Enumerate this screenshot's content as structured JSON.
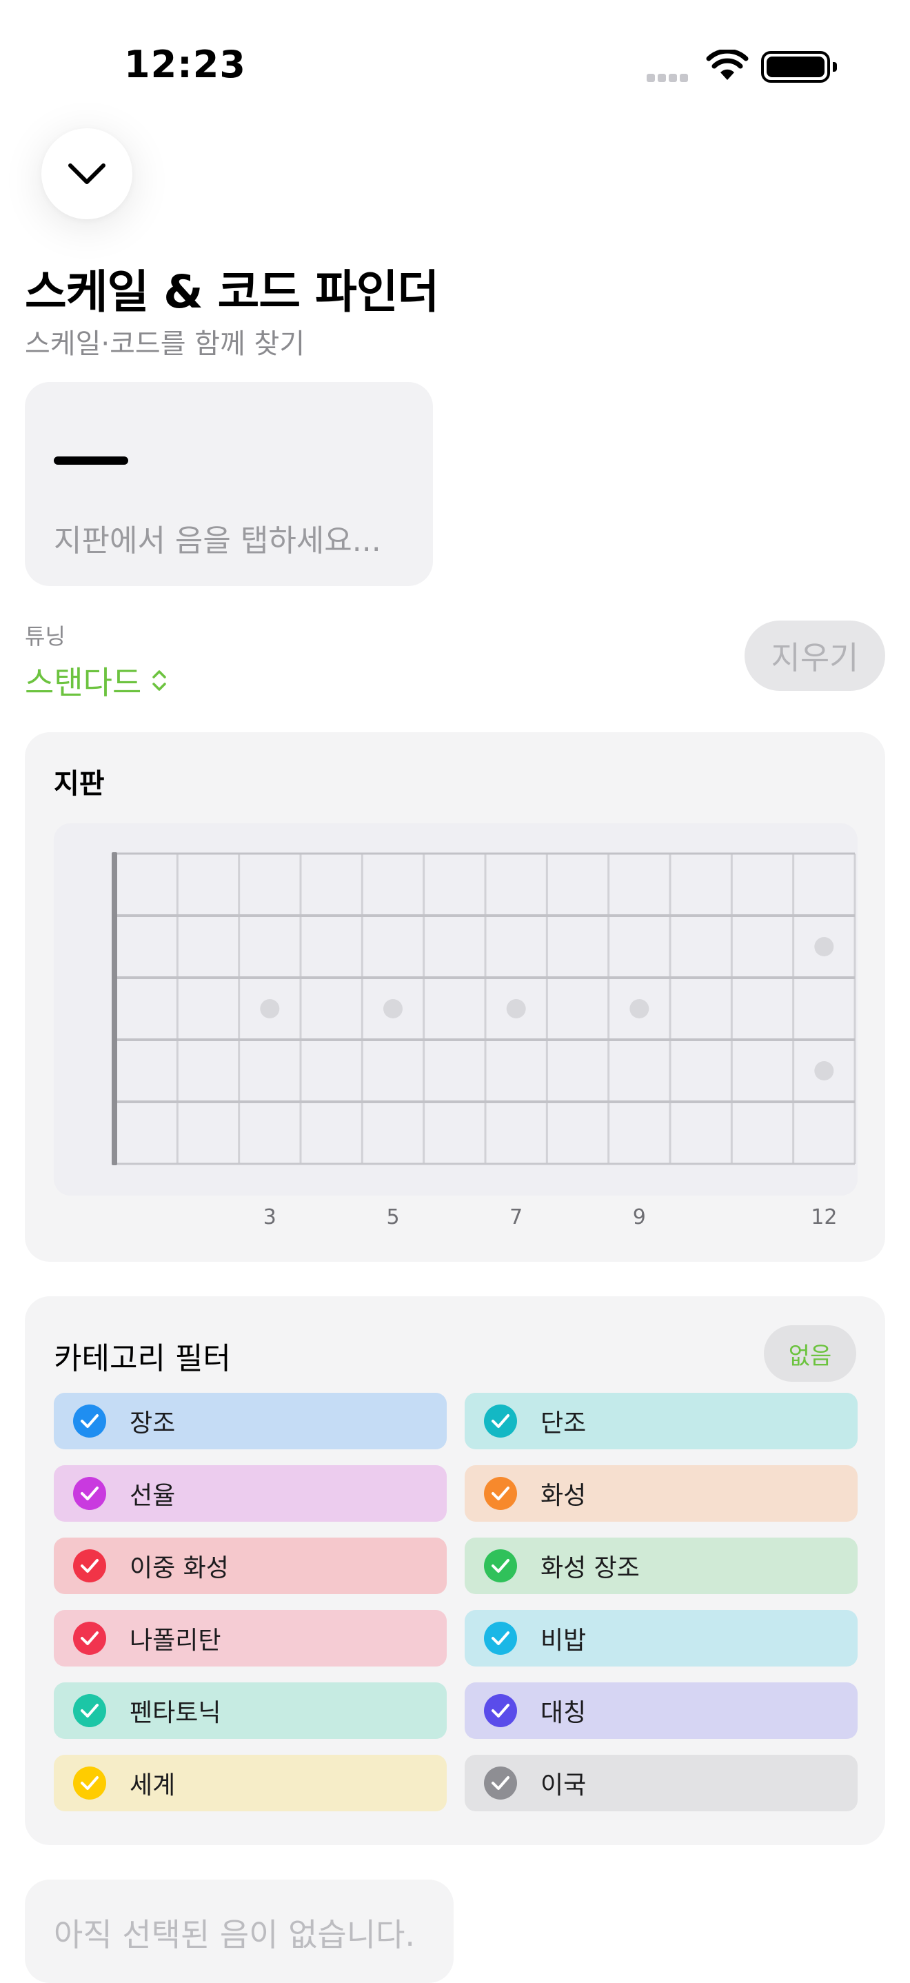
{
  "status_bar": {
    "time": "12:23"
  },
  "header": {
    "title": "스케일 & 코드 파인더",
    "subtitle": "스케일·코드를 함께 찾기"
  },
  "note_display": {
    "placeholder_dash": "—",
    "hint": "지판에서 음을 탭하세요..."
  },
  "tuning": {
    "label": "튜닝",
    "value": "스탠다드",
    "clear_label": "지우기"
  },
  "fretboard": {
    "title": "지판",
    "strings": 6,
    "frets": 12,
    "inlay_single_frets": [
      3,
      5,
      7,
      9
    ],
    "inlay_double_fret": 12,
    "fret_numbers": [
      "3",
      "5",
      "7",
      "9",
      "12"
    ]
  },
  "category_filter": {
    "title": "카테고리 필터",
    "none_label": "없음",
    "items": [
      {
        "label": "장조",
        "color": "#1f8ef1",
        "bg": "#c5dcf5",
        "checked": true
      },
      {
        "label": "단조",
        "color": "#13b8c4",
        "bg": "#c3eaea",
        "checked": true
      },
      {
        "label": "선율",
        "color": "#c93adf",
        "bg": "#ecccee",
        "checked": true
      },
      {
        "label": "화성",
        "color": "#f7892c",
        "bg": "#f6dfcf",
        "checked": true
      },
      {
        "label": "이중 화성",
        "color": "#f13447",
        "bg": "#f5c8cc",
        "checked": true
      },
      {
        "label": "화성 장조",
        "color": "#30c15a",
        "bg": "#d0ead6",
        "checked": true
      },
      {
        "label": "나폴리탄",
        "color": "#f1344f",
        "bg": "#f5ccd4",
        "checked": true
      },
      {
        "label": "비밥",
        "color": "#1ab7e6",
        "bg": "#c6e9f0",
        "checked": true
      },
      {
        "label": "펜타토닉",
        "color": "#1cc6a6",
        "bg": "#c6ebe2",
        "checked": true
      },
      {
        "label": "대칭",
        "color": "#5a4cea",
        "bg": "#d6d5f3",
        "checked": true
      },
      {
        "label": "세계",
        "color": "#ffcc00",
        "bg": "#f6edc8",
        "checked": true
      },
      {
        "label": "이국",
        "color": "#8e8e93",
        "bg": "#e2e2e4",
        "checked": true
      }
    ]
  },
  "empty_state": {
    "text": "아직 선택된 음이 없습니다."
  }
}
